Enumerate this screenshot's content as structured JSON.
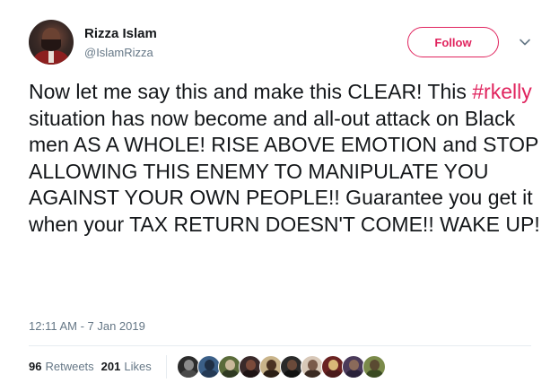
{
  "author": {
    "name": "Rizza Islam",
    "handle": "@IslamRizza"
  },
  "follow_label": "Follow",
  "tweet": {
    "text_before": "Now let me say this and make this CLEAR! This ",
    "hashtag": "#rkelly",
    "text_after": " situation has now become and all-out attack on Black men AS A WHOLE! RISE ABOVE EMOTION and STOP ALLOWING THIS ENEMY TO MANIPULATE YOU AGAINST YOUR OWN PEOPLE!! Guarantee you get it when your TAX RETURN DOESN'T COME!! WAKE UP!"
  },
  "timestamp": "12:11 AM - 7 Jan 2019",
  "stats": {
    "retweets_count": "96",
    "retweets_label": "Retweets",
    "likes_count": "201",
    "likes_label": "Likes"
  },
  "likers": [
    {
      "icon": "liker-avatar-1",
      "bg": "#2b2b2b",
      "head": "#8a8a8a",
      "body": "#4a4a4a"
    },
    {
      "icon": "liker-avatar-2",
      "bg": "#3b5f87",
      "head": "#1f2f44",
      "body": "#243a55"
    },
    {
      "icon": "liker-avatar-3",
      "bg": "#5a6b3a",
      "head": "#c9b99a",
      "body": "#2f3a22"
    },
    {
      "icon": "liker-avatar-4",
      "bg": "#3a2a2a",
      "head": "#7a4a3a",
      "body": "#1e1414"
    },
    {
      "icon": "liker-avatar-5",
      "bg": "#c9b48a",
      "head": "#4a3222",
      "body": "#2a1e14"
    },
    {
      "icon": "liker-avatar-6",
      "bg": "#2a2a2a",
      "head": "#6a4a3a",
      "body": "#111111"
    },
    {
      "icon": "liker-avatar-7",
      "bg": "#d8c8b8",
      "head": "#7a5a4a",
      "body": "#3a2a22"
    },
    {
      "icon": "liker-avatar-8",
      "bg": "#6a2222",
      "head": "#d8b878",
      "body": "#4a1a1a"
    },
    {
      "icon": "liker-avatar-9",
      "bg": "#4a3a5a",
      "head": "#8a6a5a",
      "body": "#2a223a"
    },
    {
      "icon": "liker-avatar-10",
      "bg": "#7a8a4a",
      "head": "#5a4a32",
      "body": "#3a4a22"
    }
  ],
  "colors": {
    "accent": "#e0245e",
    "secondary_text": "#657786",
    "primary_text": "#14171a"
  }
}
